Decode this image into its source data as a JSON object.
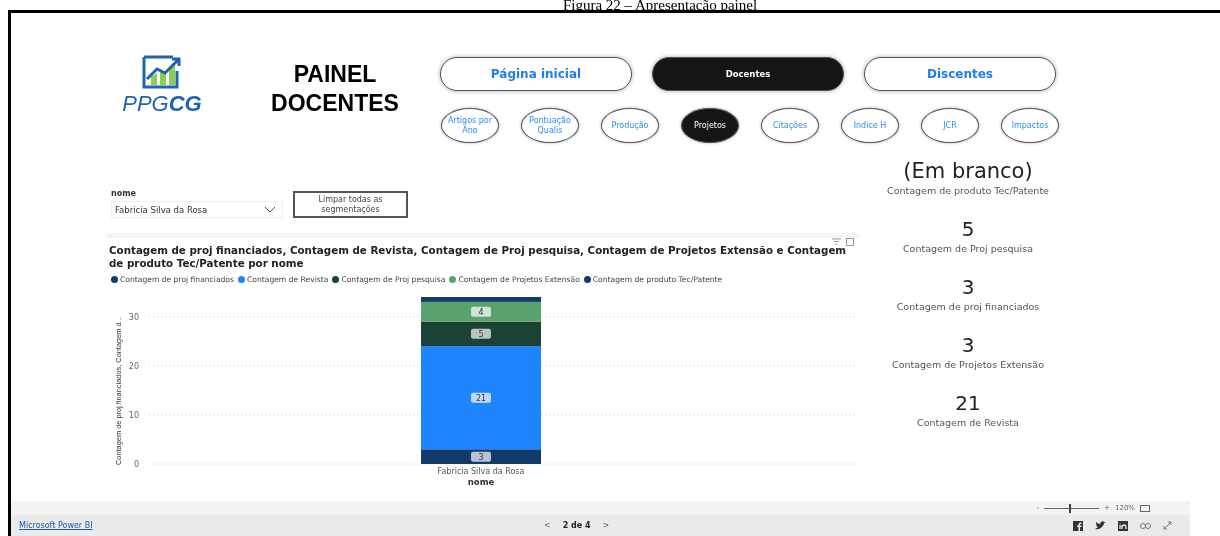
{
  "caption": "Figura 22 – Apresentação painel",
  "logo": {
    "text": "PPG**CG**"
  },
  "title": "PAINEL DOCENTES",
  "main_tabs": [
    {
      "label": "Página inicial",
      "selected": false
    },
    {
      "label": "Docentes",
      "selected": true
    },
    {
      "label": "Discentes",
      "selected": false
    }
  ],
  "sub_tabs": [
    {
      "label": "Artigos por Ano",
      "selected": false
    },
    {
      "label": "Pontuação Qualis",
      "selected": false
    },
    {
      "label": "Produção",
      "selected": false
    },
    {
      "label": "Projetos",
      "selected": true
    },
    {
      "label": "Citações",
      "selected": false
    },
    {
      "label": "Indice H",
      "selected": false
    },
    {
      "label": "JCR",
      "selected": false
    },
    {
      "label": "Impactos",
      "selected": false
    }
  ],
  "slicer": {
    "label": "nome",
    "value": "Fabricia Silva da Rosa"
  },
  "clear_button": "Limpar todas as segmentações",
  "chart": {
    "title": "Contagem de proj financiados, Contagem de Revista, Contagem de Proj pesquisa, Contagem de Projetos Extensão e Contagem de produto Tec/Patente por nome",
    "chart_data": {
      "type": "bar",
      "stacked": true,
      "grid": true,
      "xlabel": "nome",
      "ylabel": "Contagem de proj financiados, Contagem d...",
      "categories": [
        "Fabricia Silva da Rosa"
      ],
      "ylim": [
        0,
        34
      ],
      "yticks": [
        0,
        10,
        20,
        30
      ],
      "series": [
        {
          "name": "Contagem de proj financiados",
          "color": "#123b6b",
          "values": [
            3
          ]
        },
        {
          "name": "Contagem de Revista",
          "color": "#1f85ff",
          "values": [
            21
          ]
        },
        {
          "name": "Contagem de Proj pesquisa",
          "color": "#1a4235",
          "values": [
            5
          ]
        },
        {
          "name": "Contagem de Projetos Extensão",
          "color": "#5aa36f",
          "values": [
            4
          ]
        },
        {
          "name": "Contagem de produto Tec/Patente",
          "color": "#133a6a",
          "values": [
            1
          ]
        }
      ],
      "value_labels": [
        [
          "3"
        ],
        [
          "21"
        ],
        [
          "5"
        ],
        [
          "4"
        ],
        [
          null
        ]
      ]
    }
  },
  "cards": [
    {
      "value": "(Em branco)",
      "label": "Contagem de produto Tec/Patente"
    },
    {
      "value": "5",
      "label": "Contagem de Proj pesquisa"
    },
    {
      "value": "3",
      "label": "Contagem de proj financiados"
    },
    {
      "value": "3",
      "label": "Contagem de Projetos Extensão"
    },
    {
      "value": "21",
      "label": "Contagem de Revista"
    }
  ],
  "zoom": {
    "minus": "-",
    "plus": "+",
    "level": 0.45,
    "reading": "120%"
  },
  "footer": {
    "link": "Microsoft Power BI",
    "prev": "<",
    "page": "2 de 4",
    "next": ">"
  }
}
